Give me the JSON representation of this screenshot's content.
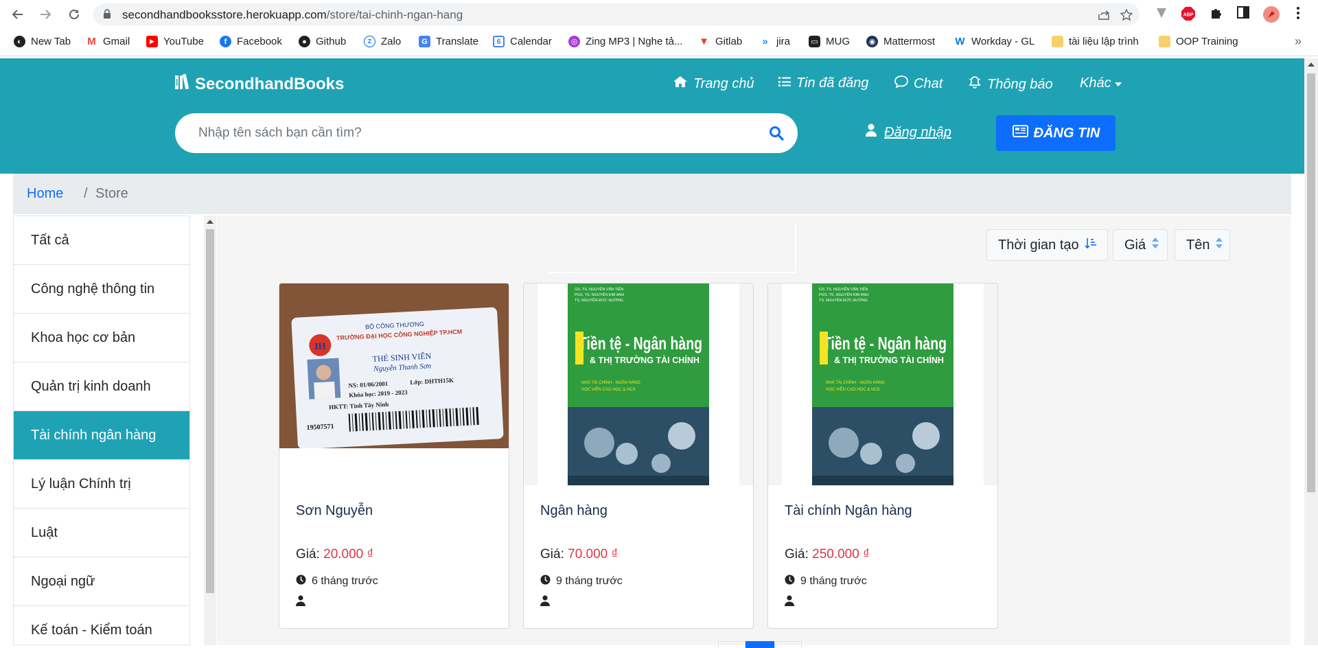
{
  "browser": {
    "url_host": "secondhandbooksstore.herokuapp.com",
    "url_path": "/store/tai-chinh-ngan-hang",
    "bookmarks": [
      {
        "label": "New Tab",
        "icon": "globe-icon",
        "color": "#202124"
      },
      {
        "label": "Gmail",
        "icon": "gmail-icon",
        "color": "#ea4335"
      },
      {
        "label": "YouTube",
        "icon": "youtube-icon",
        "color": "#ff0000"
      },
      {
        "label": "Facebook",
        "icon": "facebook-icon",
        "color": "#1877f2"
      },
      {
        "label": "Github",
        "icon": "github-icon",
        "color": "#202124"
      },
      {
        "label": "Zalo",
        "icon": "zalo-icon",
        "color": "#0068ff"
      },
      {
        "label": "Translate",
        "icon": "translate-icon",
        "color": "#4285f4"
      },
      {
        "label": "Calendar",
        "icon": "calendar-icon",
        "color": "#4285f4"
      },
      {
        "label": "Zing MP3 | Nghe tả...",
        "icon": "zing-icon",
        "color": "#a63bd3"
      },
      {
        "label": "Gitlab",
        "icon": "gitlab-icon",
        "color": "#e2432a"
      },
      {
        "label": "jira",
        "icon": "jira-icon",
        "color": "#2684ff"
      },
      {
        "label": "MUG",
        "icon": "mug-icon",
        "color": "#202124"
      },
      {
        "label": "Mattermost",
        "icon": "mattermost-icon",
        "color": "#1e325c"
      },
      {
        "label": "Workday - GL",
        "icon": "workday-icon",
        "color": "#f5a623"
      },
      {
        "label": "tài liệu lập trình",
        "icon": "folder-icon",
        "color": "#f6d16b"
      },
      {
        "label": "OOP Training",
        "icon": "folder-icon",
        "color": "#f6d16b"
      }
    ]
  },
  "header": {
    "logo": "SecondhandBooks",
    "menu": [
      {
        "label": "Trang chủ",
        "icon": "home-icon"
      },
      {
        "label": "Tin đã đăng",
        "icon": "list-icon"
      },
      {
        "label": "Chat",
        "icon": "chat-icon"
      },
      {
        "label": "Thông báo",
        "icon": "bell-icon"
      },
      {
        "label": "Khác",
        "icon": "caret-down-icon"
      }
    ],
    "search_placeholder": "Nhập tên sách bạn cần tìm?",
    "login": "Đăng nhập",
    "post_button": "ĐĂNG TIN",
    "accent": "#1fa2b4",
    "button_color": "#0d6efd"
  },
  "breadcrumb": {
    "home": "Home",
    "separator": "/",
    "current": "Store"
  },
  "categories": [
    "Tất cả",
    "Công nghệ thông tin",
    "Khoa học cơ bản",
    "Quản trị kinh doanh",
    "Tài chính ngân hàng",
    "Lý luận Chính trị",
    "Luật",
    "Ngoại ngữ",
    "Kế toán - Kiểm toán"
  ],
  "active_category": "Tài chính ngân hàng",
  "sort": {
    "time": "Thời gian tạo",
    "price": "Giá",
    "name": "Tên"
  },
  "products": [
    {
      "title": "Sơn Nguyễn",
      "price_label": "Giá:",
      "price": "20.000 ₫",
      "time": "6 tháng trước",
      "image": "student-card"
    },
    {
      "title": "Ngân hàng",
      "price_label": "Giá:",
      "price": "70.000 ₫",
      "time": "9 tháng trước",
      "image": "book-cover"
    },
    {
      "title": "Tài chính Ngân hàng",
      "price_label": "Giá:",
      "price": "250.000 ₫",
      "time": "9 tháng trước",
      "image": "book-cover"
    }
  ],
  "book_cover": {
    "authors": [
      "GS. TS. NGUYỄN VĂN TIẾN",
      "PGS. TS. NGUYỄN KIM ANH",
      "TS. NGUYỄN ĐỨC HƯỞNG"
    ],
    "title_line1": "Tiền tệ - Ngân hàng",
    "title_line2": "& THỊ TRƯỜNG TÀI CHÍNH",
    "bullets": [
      "NHÀ TÀI CHÍNH - NGÂN HÀNG",
      "HỌC VIÊN CAO HỌC & NCS"
    ],
    "green": "#2e9c3f"
  },
  "student_card": {
    "ministry": "BỘ CÔNG THƯƠNG",
    "school": "TRƯỜNG ĐẠI HỌC CÔNG NGHIỆP TP.HCM",
    "card_title": "THẺ SINH VIÊN",
    "name": "Nguyễn Thanh Sơn",
    "dob": "NS: 01/06/2001",
    "class": "Lớp: DHTH15K",
    "course": "Khóa học: 2019 - 2023",
    "hometown": "HKTT: Tỉnh Tây Ninh",
    "id": "19507571"
  }
}
